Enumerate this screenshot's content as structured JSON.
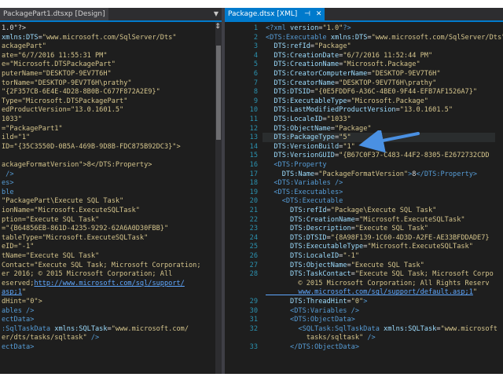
{
  "left_pane": {
    "tab_title": "PackagePart1.dtsxp [Design]",
    "lines": [
      {
        "y": 1,
        "segs": [
          [
            "t-txt",
            "1.0\"?>"
          ]
        ]
      },
      {
        "y": 2,
        "segs": [
          [
            "t-attr",
            "xmlns:DTS"
          ],
          [
            "t-txt",
            "="
          ],
          [
            "t-val",
            "\"www.microsoft.com/SqlServer/Dts\""
          ]
        ]
      },
      {
        "y": 3,
        "segs": [
          [
            "t-val",
            "ackagePart\""
          ]
        ]
      },
      {
        "y": 4,
        "segs": [
          [
            "t-val",
            "ate=\"6/7/2016 11:55:31 PM\""
          ]
        ]
      },
      {
        "y": 5,
        "segs": [
          [
            "t-val",
            "e=\"Microsoft.DTSPackagePart\""
          ]
        ]
      },
      {
        "y": 6,
        "segs": [
          [
            "t-val",
            "puterName=\"DESKTOP-9EV7T6H\""
          ]
        ]
      },
      {
        "y": 7,
        "segs": [
          [
            "t-val",
            "torName=\"DESKTOP-9EV7T6H\\prathy\""
          ]
        ]
      },
      {
        "y": 8,
        "segs": [
          [
            "t-val",
            "\"{2F357CB-6E4E-4D28-8B0B-C677F872A2E9}\""
          ]
        ]
      },
      {
        "y": 9,
        "segs": [
          [
            "t-val",
            "Type=\"Microsoft.DTSPackagePart\""
          ]
        ]
      },
      {
        "y": 10,
        "segs": [
          [
            "t-val",
            "edProductVersion=\"13.0.1601.5\""
          ]
        ]
      },
      {
        "y": 11,
        "segs": [
          [
            "t-val",
            "1033\""
          ]
        ]
      },
      {
        "y": 12,
        "segs": [
          [
            "t-val",
            "=\"PackagePart1\""
          ]
        ]
      },
      {
        "y": 13,
        "segs": [
          [
            "t-val",
            "ild=\"1\""
          ]
        ]
      },
      {
        "y": 14,
        "segs": [
          [
            "t-val",
            "ID=\"{35C3550D-0B5A-469B-9D8B-FDC875B92DC3}\">"
          ]
        ]
      },
      {
        "y": 16,
        "segs": [
          [
            "t-val",
            "ackageFormatVersion\">8</DTS:Property>"
          ]
        ]
      },
      {
        "y": 17,
        "segs": [
          [
            "t-tag",
            " />"
          ]
        ]
      },
      {
        "y": 18,
        "segs": [
          [
            "t-tag",
            "es>"
          ]
        ]
      },
      {
        "y": 19,
        "segs": [
          [
            "t-tag",
            "ble"
          ]
        ]
      },
      {
        "y": 20,
        "segs": [
          [
            "t-val",
            "\"PackagePart\\Execute SQL Task\""
          ]
        ]
      },
      {
        "y": 21,
        "segs": [
          [
            "t-val",
            "ionName=\"Microsoft.ExecuteSQLTask\""
          ]
        ]
      },
      {
        "y": 22,
        "segs": [
          [
            "t-val",
            "ption=\"Execute SQL Task\""
          ]
        ]
      },
      {
        "y": 23,
        "segs": [
          [
            "t-val",
            "=\"{B64856EB-861D-4235-9292-62A6A0D30FBB}\""
          ]
        ]
      },
      {
        "y": 24,
        "segs": [
          [
            "t-val",
            "tableType=\"Microsoft.ExecuteSQLTask\""
          ]
        ]
      },
      {
        "y": 25,
        "segs": [
          [
            "t-val",
            "eID=\"-1\""
          ]
        ]
      },
      {
        "y": 26,
        "segs": [
          [
            "t-val",
            "tName=\"Execute SQL Task\""
          ]
        ]
      },
      {
        "y": 27,
        "segs": [
          [
            "t-val",
            "Contact=\"Execute SQL Task; Microsoft Corporation;"
          ]
        ]
      },
      {
        "y": 28,
        "segs": [
          [
            "t-val",
            "er 2016; © 2015 Microsoft Corporation; All"
          ]
        ]
      },
      {
        "y": 29,
        "segs": [
          [
            "t-val",
            "eserved;"
          ],
          [
            "t-link",
            "http://www.microsoft.com/sql/support/"
          ]
        ]
      },
      {
        "y": 30,
        "segs": [
          [
            "t-link",
            "asp;1"
          ],
          [
            "t-val",
            "\""
          ]
        ]
      },
      {
        "y": 31,
        "segs": [
          [
            "t-val",
            "dHint=\"0\">"
          ]
        ]
      },
      {
        "y": 32,
        "segs": [
          [
            "t-tag",
            "ables />"
          ]
        ]
      },
      {
        "y": 33,
        "segs": [
          [
            "t-tag",
            "ectData>"
          ]
        ]
      },
      {
        "y": 34,
        "segs": [
          [
            "t-tag",
            ":SqlTaskData "
          ],
          [
            "t-attr",
            "xmlns:SQLTask"
          ],
          [
            "t-txt",
            "="
          ],
          [
            "t-val",
            "\"www.microsoft.com/"
          ]
        ]
      },
      {
        "y": 35,
        "segs": [
          [
            "t-val",
            "er/dts/tasks/sqltask\""
          ],
          [
            "t-tag",
            " />"
          ]
        ]
      },
      {
        "y": 36,
        "segs": [
          [
            "t-tag",
            "ectData>"
          ]
        ]
      }
    ]
  },
  "right_pane": {
    "tab_title": "Package.dtsx [XML]",
    "lines": [
      {
        "n": "1",
        "segs": [
          [
            "t-tag",
            "<?xml "
          ],
          [
            "t-attr",
            "version"
          ],
          [
            "t-txt",
            "="
          ],
          [
            "t-val",
            "\"1.0\""
          ],
          [
            "t-tag",
            "?>"
          ]
        ]
      },
      {
        "n": "2",
        "segs": [
          [
            "t-tag",
            "<DTS:Executable "
          ],
          [
            "t-attr",
            "xmlns:DTS"
          ],
          [
            "t-txt",
            "="
          ],
          [
            "t-val",
            "\"www.microsoft.com/SqlServer/Dts\""
          ]
        ]
      },
      {
        "n": "3",
        "segs": [
          [
            "t-attr",
            "  DTS:refId"
          ],
          [
            "t-txt",
            "="
          ],
          [
            "t-val",
            "\"Package\""
          ]
        ]
      },
      {
        "n": "4",
        "segs": [
          [
            "t-attr",
            "  DTS:CreationDate"
          ],
          [
            "t-txt",
            "="
          ],
          [
            "t-val",
            "\"6/7/2016 11:52:44 PM\""
          ]
        ]
      },
      {
        "n": "5",
        "segs": [
          [
            "t-attr",
            "  DTS:CreationName"
          ],
          [
            "t-txt",
            "="
          ],
          [
            "t-val",
            "\"Microsoft.Package\""
          ]
        ]
      },
      {
        "n": "6",
        "segs": [
          [
            "t-attr",
            "  DTS:CreatorComputerName"
          ],
          [
            "t-txt",
            "="
          ],
          [
            "t-val",
            "\"DESKTOP-9EV7T6H\""
          ]
        ]
      },
      {
        "n": "7",
        "segs": [
          [
            "t-attr",
            "  DTS:CreatorName"
          ],
          [
            "t-txt",
            "="
          ],
          [
            "t-val",
            "\"DESKTOP-9EV7T6H\\prathy\""
          ]
        ]
      },
      {
        "n": "8",
        "segs": [
          [
            "t-attr",
            "  DTS:DTSID"
          ],
          [
            "t-txt",
            "="
          ],
          [
            "t-val",
            "\"{0E5FDDF6-A36C-4BE0-9F44-EFB7AF1526A7}\""
          ]
        ]
      },
      {
        "n": "9",
        "segs": [
          [
            "t-attr",
            "  DTS:ExecutableType"
          ],
          [
            "t-txt",
            "="
          ],
          [
            "t-val",
            "\"Microsoft.Package\""
          ]
        ]
      },
      {
        "n": "10",
        "segs": [
          [
            "t-attr",
            "  DTS:LastModifiedProductVersion"
          ],
          [
            "t-txt",
            "="
          ],
          [
            "t-val",
            "\"13.0.1601.5\""
          ]
        ]
      },
      {
        "n": "11",
        "segs": [
          [
            "t-attr",
            "  DTS:LocaleID"
          ],
          [
            "t-txt",
            "="
          ],
          [
            "t-val",
            "\"1033\""
          ]
        ]
      },
      {
        "n": "12",
        "segs": [
          [
            "t-attr",
            "  DTS:ObjectName"
          ],
          [
            "t-txt",
            "="
          ],
          [
            "t-val",
            "\"Package\""
          ]
        ]
      },
      {
        "n": "13",
        "segs": [
          [
            "t-attr",
            "  DTS:PackageType"
          ],
          [
            "t-txt",
            "="
          ],
          [
            "t-val",
            "\"5\""
          ]
        ]
      },
      {
        "n": "14",
        "segs": [
          [
            "t-attr",
            "  DTS:VersionBuild"
          ],
          [
            "t-txt",
            "="
          ],
          [
            "t-val",
            "\"1\""
          ]
        ]
      },
      {
        "n": "15",
        "segs": [
          [
            "t-attr",
            "  DTS:VersionGUID"
          ],
          [
            "t-txt",
            "="
          ],
          [
            "t-val",
            "\"{B67C0F37-C483-44F2-8305-E2672732CDD"
          ]
        ]
      },
      {
        "n": "16",
        "segs": [
          [
            "t-tag",
            "  <DTS:Property"
          ]
        ]
      },
      {
        "n": "17",
        "segs": [
          [
            "t-attr",
            "    DTS:Name"
          ],
          [
            "t-txt",
            "="
          ],
          [
            "t-val",
            "\"PackageFormatVersion\""
          ],
          [
            "t-tag",
            ">"
          ],
          [
            "t-txt",
            "8"
          ],
          [
            "t-tag",
            "</DTS:Property>"
          ]
        ]
      },
      {
        "n": "18",
        "segs": [
          [
            "t-tag",
            "  <DTS:Variables />"
          ]
        ]
      },
      {
        "n": "19",
        "segs": [
          [
            "t-tag",
            "  <DTS:Executables>"
          ]
        ]
      },
      {
        "n": "20",
        "segs": [
          [
            "t-tag",
            "    <DTS:Executable"
          ]
        ]
      },
      {
        "n": "21",
        "segs": [
          [
            "t-attr",
            "      DTS:refId"
          ],
          [
            "t-txt",
            "="
          ],
          [
            "t-val",
            "\"Package\\Execute SQL Task\""
          ]
        ]
      },
      {
        "n": "22",
        "segs": [
          [
            "t-attr",
            "      DTS:CreationName"
          ],
          [
            "t-txt",
            "="
          ],
          [
            "t-val",
            "\"Microsoft.ExecuteSQLTask\""
          ]
        ]
      },
      {
        "n": "23",
        "segs": [
          [
            "t-attr",
            "      DTS:Description"
          ],
          [
            "t-txt",
            "="
          ],
          [
            "t-val",
            "\"Execute SQL Task\""
          ]
        ]
      },
      {
        "n": "24",
        "segs": [
          [
            "t-attr",
            "      DTS:DTSID"
          ],
          [
            "t-txt",
            "="
          ],
          [
            "t-val",
            "\"{8A98F139-1C60-4D3D-A2FE-AE33BFDDADE7}"
          ]
        ]
      },
      {
        "n": "25",
        "segs": [
          [
            "t-attr",
            "      DTS:ExecutableType"
          ],
          [
            "t-txt",
            "="
          ],
          [
            "t-val",
            "\"Microsoft.ExecuteSQLTask\""
          ]
        ]
      },
      {
        "n": "26",
        "segs": [
          [
            "t-attr",
            "      DTS:LocaleID"
          ],
          [
            "t-txt",
            "="
          ],
          [
            "t-val",
            "\"-1\""
          ]
        ]
      },
      {
        "n": "27",
        "segs": [
          [
            "t-attr",
            "      DTS:ObjectName"
          ],
          [
            "t-txt",
            "="
          ],
          [
            "t-val",
            "\"Execute SQL Task\""
          ]
        ]
      },
      {
        "n": "28",
        "segs": [
          [
            "t-attr",
            "      DTS:TaskContact"
          ],
          [
            "t-txt",
            "="
          ],
          [
            "t-val",
            "\"Execute SQL Task; Microsoft Corpo"
          ]
        ]
      },
      {
        "n": "",
        "segs": [
          [
            "t-val",
            "        © 2015 Microsoft Corporation; All Rights Reserv"
          ]
        ]
      },
      {
        "n": "",
        "segs": [
          [
            "t-link",
            "        www.microsoft.com/sql/support/default.asp;1"
          ],
          [
            "t-val",
            "\""
          ]
        ]
      },
      {
        "n": "29",
        "segs": [
          [
            "t-attr",
            "      DTS:ThreadHint"
          ],
          [
            "t-txt",
            "="
          ],
          [
            "t-val",
            "\"0\""
          ],
          [
            "t-tag",
            ">"
          ]
        ]
      },
      {
        "n": "30",
        "segs": [
          [
            "t-tag",
            "      <DTS:Variables />"
          ]
        ]
      },
      {
        "n": "31",
        "segs": [
          [
            "t-tag",
            "      <DTS:ObjectData>"
          ]
        ]
      },
      {
        "n": "32",
        "segs": [
          [
            "t-tag",
            "        <SQLTask:SqlTaskData "
          ],
          [
            "t-attr",
            "xmlns:SQLTask"
          ],
          [
            "t-txt",
            "="
          ],
          [
            "t-val",
            "\"www.microsoft"
          ]
        ]
      },
      {
        "n": "",
        "segs": [
          [
            "t-val",
            "          tasks/sqltask\""
          ],
          [
            "t-tag",
            " />"
          ]
        ]
      },
      {
        "n": "33",
        "segs": [
          [
            "t-tag",
            "      </DTS:ObjectData>"
          ]
        ]
      }
    ]
  },
  "icons": {
    "pin": "pin-icon",
    "close": "close-icon",
    "dropdown": "chevron-down-icon",
    "pointer": "callout-arrow"
  }
}
